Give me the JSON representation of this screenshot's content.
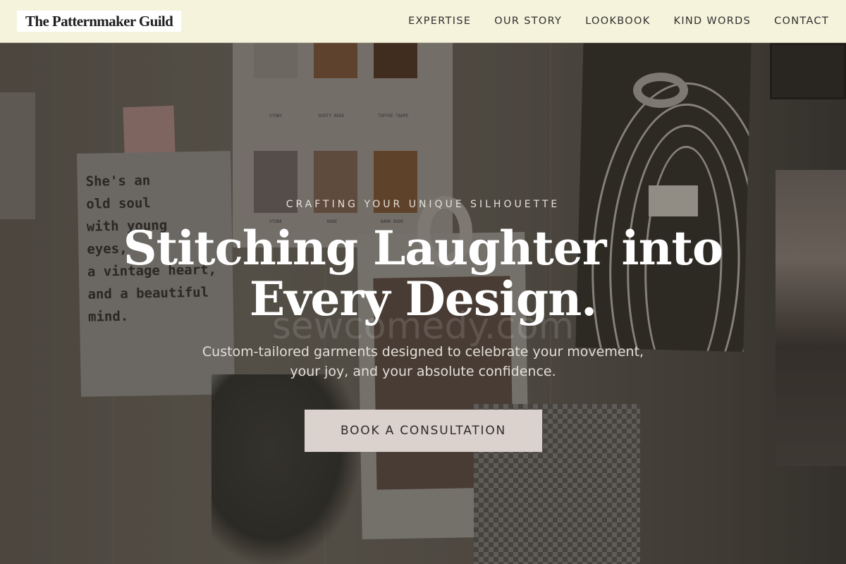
{
  "header": {
    "logo": "The Patternmaker Guild",
    "nav": [
      "EXPERTISE",
      "OUR STORY",
      "LOOKBOOK",
      "KIND WORDS",
      "CONTACT"
    ]
  },
  "hero": {
    "eyebrow": "CRAFTING YOUR UNIQUE SILHOUETTE",
    "headline_line1": "Stitching Laughter into",
    "headline_line2": "Every Design.",
    "watermark": "sewcomedy.com",
    "subline_line1": "Custom-tailored garments designed to celebrate your movement,",
    "subline_line2": "your joy, and your absolute confidence.",
    "cta": "BOOK A CONSULTATION"
  },
  "background": {
    "quote": "She's an\nold soul\nwith young\neyes,\na vintage heart,\nand a beautiful\nmind.",
    "swatches": [
      "STONY",
      "DUSTY ROSE",
      "TOFFEE TAUPE",
      "STONE",
      "NUDE",
      "DARK NUDE"
    ]
  },
  "colors": {
    "header_bg": "#f5f3dc",
    "cta_bg": "#dbd1cd",
    "headline": "#ffffff"
  }
}
